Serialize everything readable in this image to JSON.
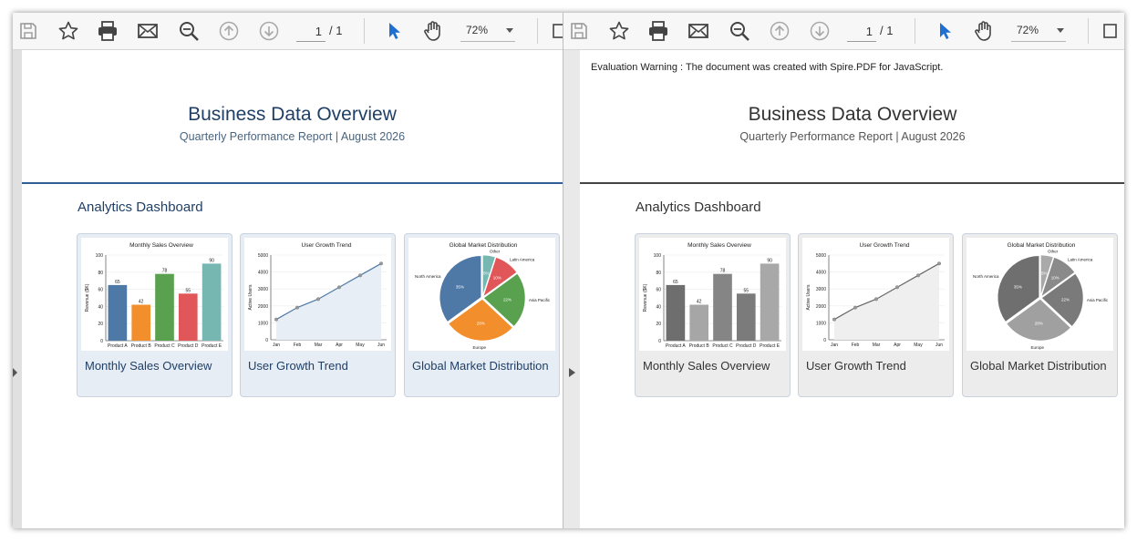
{
  "toolbar": {
    "page_current": "1",
    "page_total": "/  1",
    "zoom": "72%"
  },
  "document": {
    "warning": "Evaluation Warning : The document was created with Spire.PDF for JavaScript.",
    "title": "Business Data Overview",
    "subtitle": "Quarterly Performance Report | August 2026",
    "section": "Analytics Dashboard",
    "cards": [
      {
        "caption": "Monthly Sales Overview"
      },
      {
        "caption": "User Growth Trend"
      },
      {
        "caption": "Global Market Distribution"
      }
    ]
  },
  "color_version": {
    "title_color": "#1f3f66",
    "subtitle_color": "#4a6580",
    "rule_color": "#2f5f96",
    "section_color": "#1f3f66",
    "caption_color": "#1f3f66",
    "card_bg": "#e7edf5"
  },
  "gray_version": {
    "title_color": "#333333",
    "subtitle_color": "#555555",
    "rule_color": "#444444",
    "section_color": "#333333",
    "caption_color": "#333333",
    "card_bg": "#ececec"
  },
  "chart_data": [
    {
      "type": "bar",
      "title": "Monthly Sales Overview",
      "ylabel": "Revenue ($K)",
      "xlabel": "",
      "categories": [
        "Product A",
        "Product B",
        "Product C",
        "Product D",
        "Product E"
      ],
      "values": [
        65,
        42,
        78,
        55,
        90
      ],
      "ylim": [
        0,
        100
      ],
      "yticks": [
        0,
        20,
        40,
        60,
        80,
        100
      ],
      "colors": [
        "#4e79a7",
        "#f28e2b",
        "#59a14f",
        "#e15759",
        "#76b7b2"
      ],
      "gray_colors": [
        "#6e6e6e",
        "#a6a6a6",
        "#858585",
        "#7b7b7b",
        "#a8a8a8"
      ]
    },
    {
      "type": "line",
      "title": "User Growth Trend",
      "ylabel": "Active Users",
      "xlabel": "",
      "categories": [
        "Jan",
        "Feb",
        "Mar",
        "Apr",
        "May",
        "Jun"
      ],
      "values": [
        1200,
        1900,
        2400,
        3100,
        3800,
        4500
      ],
      "ylim": [
        0,
        5000
      ],
      "yticks": [
        0,
        1000,
        2000,
        3000,
        4000,
        5000
      ],
      "color": "#4e79a7",
      "gray_color": "#666666",
      "fill": "#e8eef6",
      "gray_fill": "#efefef"
    },
    {
      "type": "pie",
      "title": "Global Market Distribution",
      "labels": [
        "Other",
        "Latin America",
        "Asia Pacific",
        "Europe",
        "North America"
      ],
      "values": [
        5,
        10,
        22,
        28,
        35
      ],
      "percent_labels": [
        "5%",
        "10%",
        "22%",
        "28%",
        "35%"
      ],
      "colors": [
        "#76b7b2",
        "#e15759",
        "#59a14f",
        "#f28e2b",
        "#4e79a7"
      ],
      "gray_colors": [
        "#a9a9a9",
        "#8a8a8a",
        "#7a7a7a",
        "#a0a0a0",
        "#6f6f6f"
      ]
    }
  ]
}
